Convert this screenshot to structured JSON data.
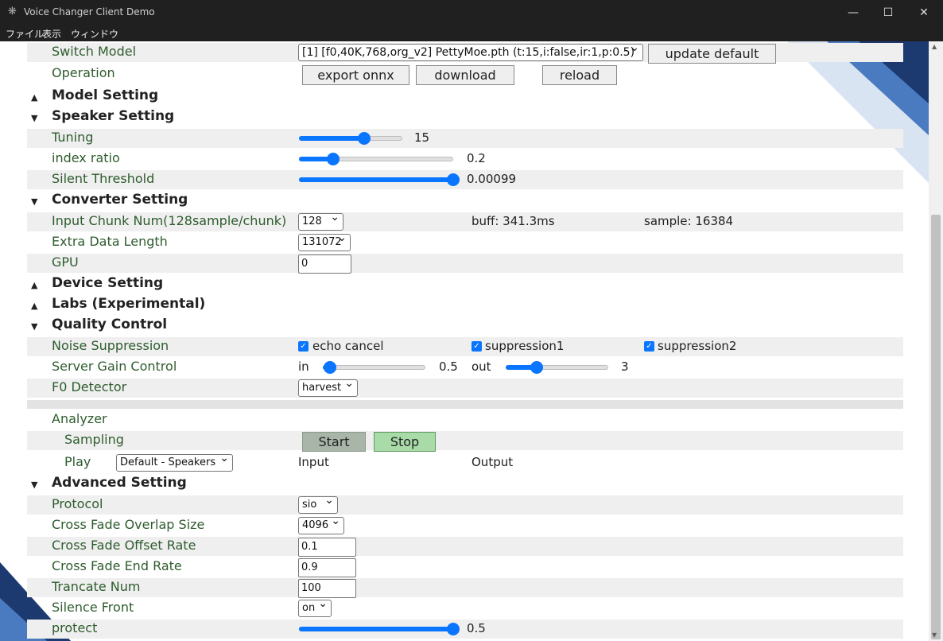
{
  "window": {
    "title": "Voice Changer Client Demo",
    "menu": [
      "ファイル",
      "表示",
      "ウィンドウ"
    ]
  },
  "rows": {
    "switch_model": {
      "label": "Switch Model",
      "select": "[1] [f0,40K,768,org_v2] PettyMoe.pth (t:15,i:false,ir:1,p:0.5)",
      "button": "update default"
    },
    "operation": {
      "label": "Operation",
      "buttons": [
        "export onnx",
        "download",
        "reload"
      ]
    },
    "tuning": {
      "label": "Tuning",
      "value": "15",
      "fraction": 0.63
    },
    "index_ratio": {
      "label": "index ratio",
      "value": "0.2",
      "fraction": 0.22
    },
    "silent_threshold": {
      "label": "Silent Threshold",
      "value": "0.00099",
      "fraction": 1.0
    },
    "input_chunk": {
      "label": "Input Chunk Num(128sample/chunk)",
      "select": "128",
      "buff": "buff: 341.3ms",
      "sample": "sample: 16384"
    },
    "extra_data": {
      "label": "Extra Data Length",
      "select": "131072"
    },
    "gpu": {
      "label": "GPU",
      "value": "0"
    },
    "noise": {
      "label": "Noise Suppression",
      "options": [
        "echo cancel",
        "suppression1",
        "suppression2"
      ]
    },
    "gain": {
      "label": "Server Gain Control",
      "in_label": "in",
      "in_value": "0.5",
      "in_fraction": 0.07,
      "out_label": "out",
      "out_value": "3",
      "out_fraction": 0.3
    },
    "f0": {
      "label": "F0 Detector",
      "select": "harvest"
    },
    "analyzer": {
      "label": "Analyzer"
    },
    "sampling": {
      "label": "Sampling",
      "start": "Start",
      "stop": "Stop"
    },
    "play": {
      "label": "Play",
      "select": "Default - Speakers",
      "input": "Input",
      "output": "Output"
    },
    "protocol": {
      "label": "Protocol",
      "select": "sio"
    },
    "cf_overlap": {
      "label": "Cross Fade Overlap Size",
      "select": "4096"
    },
    "cf_offset": {
      "label": "Cross Fade Offset Rate",
      "value": "0.1"
    },
    "cf_end": {
      "label": "Cross Fade End Rate",
      "value": "0.9"
    },
    "trancate": {
      "label": "Trancate Num",
      "value": "100"
    },
    "silence_front": {
      "label": "Silence Front",
      "select": "on"
    },
    "protect": {
      "label": "protect",
      "value": "0.5",
      "fraction": 1.0
    }
  },
  "sections": {
    "model": "Model Setting",
    "speaker": "Speaker Setting",
    "converter": "Converter Setting",
    "device": "Device Setting",
    "labs": "Labs (Experimental)",
    "quality": "Quality Control",
    "advanced": "Advanced Setting"
  },
  "colors": {
    "accent": "#0a75ff",
    "label_green": "#2e5c2e",
    "titlebar": "#202020"
  }
}
